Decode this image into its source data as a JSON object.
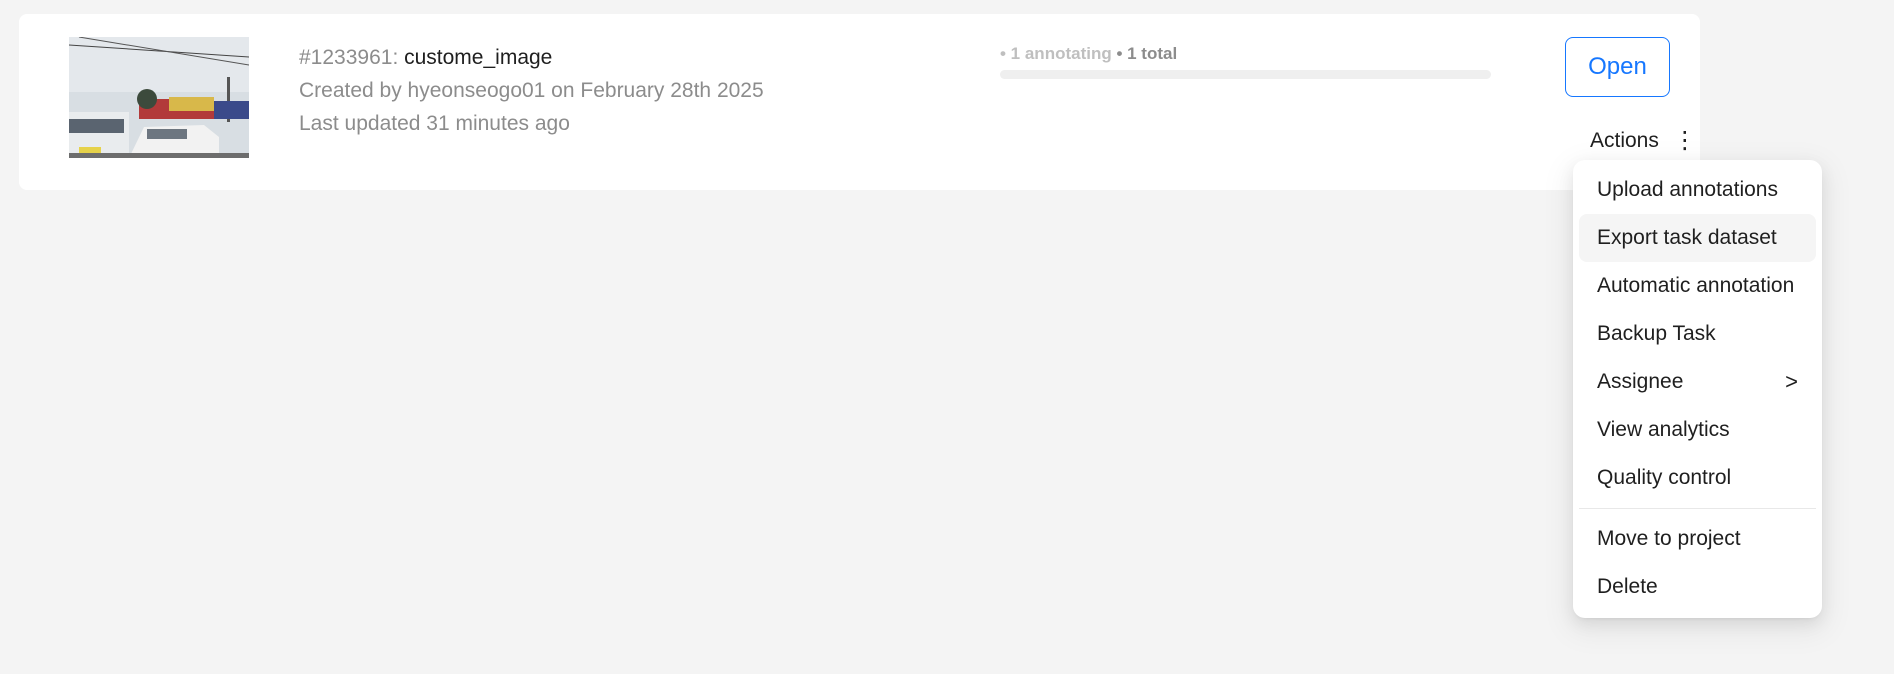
{
  "task": {
    "id": "#1233961",
    "id_separator": ": ",
    "name": "custome_image",
    "created": "Created by hyeonseogo01 on February 28th 2025",
    "updated": "Last updated 31 minutes ago",
    "thumbnail_icon": "image-thumbnail"
  },
  "progress": {
    "annotating": "• 1 annotating",
    "total": " • 1 total",
    "completed_fraction": 0
  },
  "buttons": {
    "open": "Open",
    "actions": "Actions",
    "actions_icon": "more-vertical-icon"
  },
  "menu": {
    "items": [
      {
        "label": "Upload annotations"
      },
      {
        "label": "Export task dataset"
      },
      {
        "label": "Automatic annotation"
      },
      {
        "label": "Backup Task"
      },
      {
        "label": "Assignee",
        "submenu_icon": "chevron-right-icon"
      },
      {
        "label": "View analytics"
      },
      {
        "label": "Quality control"
      },
      {
        "label": "Move to project"
      },
      {
        "label": "Delete"
      }
    ]
  },
  "colors": {
    "accent": "#1677ff",
    "background": "#f4f4f4",
    "card": "#ffffff",
    "menu_hover": "#f5f5f5"
  }
}
